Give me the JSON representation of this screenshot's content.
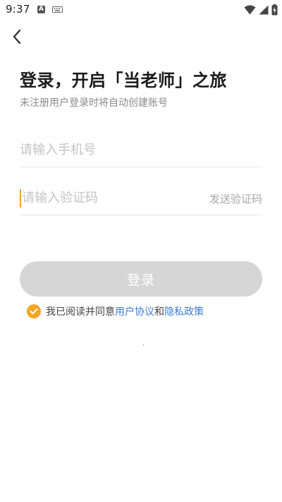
{
  "status_bar": {
    "time": "9:37",
    "notification_icons": [
      "a-letter-icon",
      "keyboard-icon"
    ],
    "system_icons": [
      "wifi-icon",
      "cellular-signal-icon",
      "battery-charging-icon"
    ]
  },
  "header": {
    "back_icon": "chevron-left-icon"
  },
  "login": {
    "title": "登录，开启「当老师」之旅",
    "subtitle": "未注册用户登录时将自动创建账号",
    "phone_placeholder": "请输入手机号",
    "code_placeholder": "请输入验证码",
    "send_code_label": "发送验证码",
    "submit_label": "登录"
  },
  "agreement": {
    "checked": true,
    "prefix": "我已阅读并同意",
    "user_agreement": "用户协议",
    "connector": "和",
    "privacy_policy": "隐私政策"
  },
  "colors": {
    "accent": "#f5a623",
    "link": "#3b7dd8",
    "button_disabled": "#d6d6d6",
    "placeholder": "#c4c4c4"
  }
}
